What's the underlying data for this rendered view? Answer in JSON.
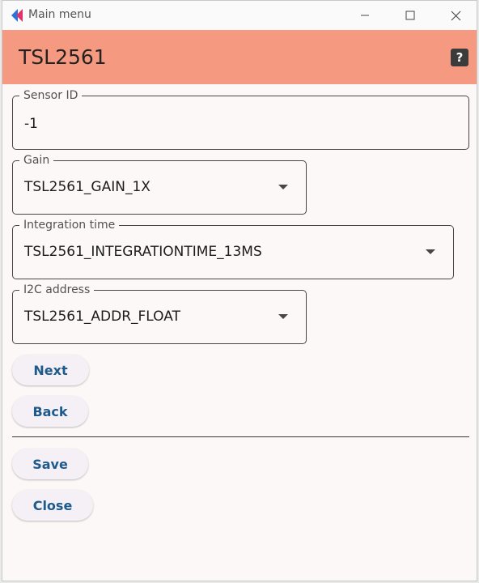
{
  "window": {
    "title": "Main menu",
    "controls": [
      "minimize-icon",
      "maximize-icon",
      "close-icon"
    ]
  },
  "appbar": {
    "title": "TSL2561",
    "help_label": "?"
  },
  "fields": {
    "sensor_id": {
      "label": "Sensor ID",
      "value": "-1"
    },
    "gain": {
      "label": "Gain",
      "value": "TSL2561_GAIN_1X"
    },
    "integration_time": {
      "label": "Integration time",
      "value": "TSL2561_INTEGRATIONTIME_13MS"
    },
    "i2c_address": {
      "label": "I2C address",
      "value": "TSL2561_ADDR_FLOAT"
    }
  },
  "buttons": {
    "next": "Next",
    "back": "Back",
    "save": "Save",
    "close": "Close"
  },
  "colors": {
    "appbar": "#f59a80",
    "button_text": "#1f5a8c",
    "button_bg": "#f4f0f5"
  }
}
